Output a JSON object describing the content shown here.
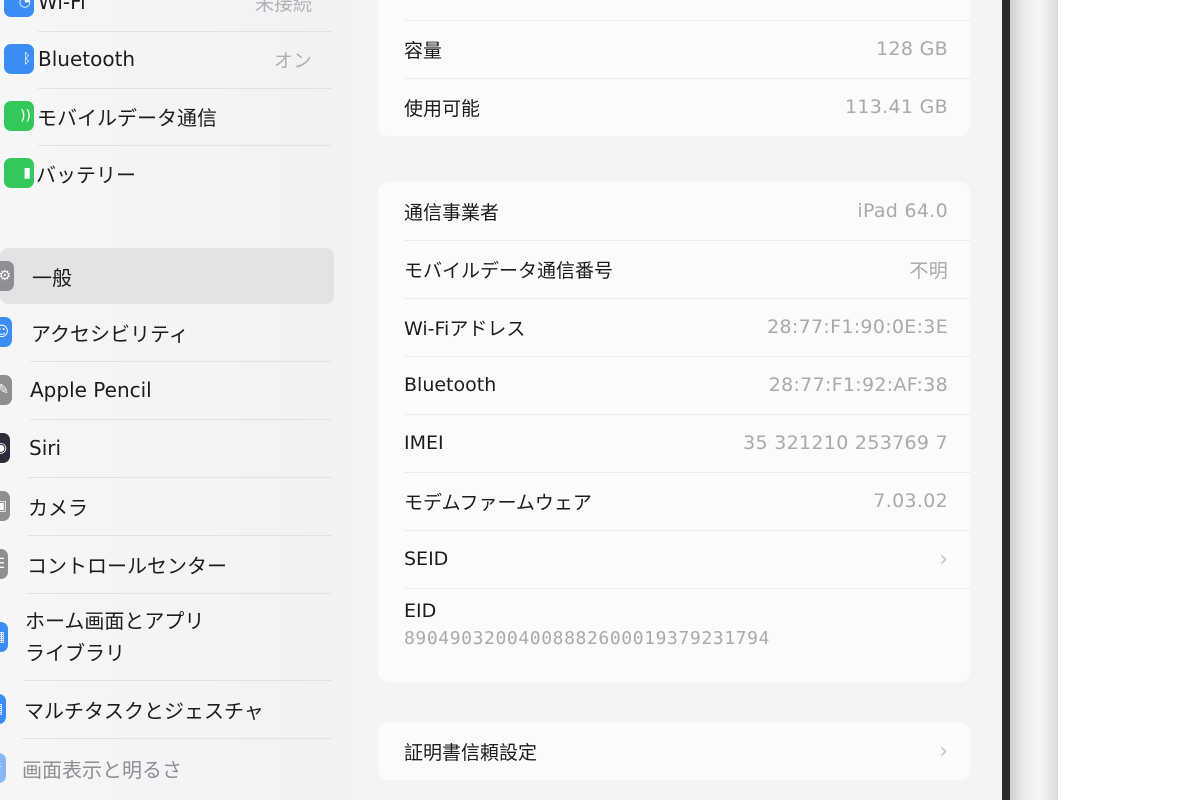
{
  "sidebar": {
    "items": [
      {
        "label": "Wi-Fi",
        "value": "未接続",
        "icon": "wifi-icon",
        "color": "#3b8cf5"
      },
      {
        "label": "Bluetooth",
        "value": "オン",
        "icon": "bluetooth-icon",
        "color": "#3b8cf5"
      },
      {
        "label": "モバイルデータ通信",
        "value": "",
        "icon": "antenna-icon",
        "color": "#34c759"
      },
      {
        "label": "バッテリー",
        "value": "",
        "icon": "battery-icon",
        "color": "#34c759"
      },
      {
        "label": "一般",
        "value": "",
        "icon": "gear-icon",
        "color": "#8e8e93"
      },
      {
        "label": "アクセシビリティ",
        "value": "",
        "icon": "accessibility-icon",
        "color": "#3b8cf5"
      },
      {
        "label": "Apple Pencil",
        "value": "",
        "icon": "pencil-icon",
        "color": "#8e8e93"
      },
      {
        "label": "Siri",
        "value": "",
        "icon": "siri-icon",
        "color": "#2d2d3a"
      },
      {
        "label": "カメラ",
        "value": "",
        "icon": "camera-icon",
        "color": "#8e8e93"
      },
      {
        "label": "コントロールセンター",
        "value": "",
        "icon": "control-center-icon",
        "color": "#8e8e93"
      },
      {
        "label": "ホーム画面とアプリライブラリ",
        "label_line1": "ホーム画面とアプリ",
        "label_line2": "ライブラリ",
        "value": "",
        "icon": "home-screen-icon",
        "color": "#3b8cf5"
      },
      {
        "label": "マルチタスクとジェスチャ",
        "value": "",
        "icon": "multitask-icon",
        "color": "#3b8cf5"
      },
      {
        "label": "画面表示と明るさ",
        "value": "",
        "icon": "display-icon",
        "color": "#3b8cf5"
      }
    ],
    "selected": "一般"
  },
  "main": {
    "storage_group": [
      {
        "label": "容量",
        "value": "128 GB"
      },
      {
        "label": "使用可能",
        "value": "113.41 GB"
      }
    ],
    "network_group": [
      {
        "label": "通信事業者",
        "value": "iPad 64.0"
      },
      {
        "label": "モバイルデータ通信番号",
        "value": "不明"
      },
      {
        "label": "Wi-Fiアドレス",
        "value": "28:77:F1:90:0E:3E"
      },
      {
        "label": "Bluetooth",
        "value": "28:77:F1:92:AF:38"
      },
      {
        "label": "IMEI",
        "value": "35 321210 253769 7"
      },
      {
        "label": "モデムファームウェア",
        "value": "7.03.02"
      },
      {
        "label": "SEID",
        "value": ""
      }
    ],
    "eid": {
      "label": "EID",
      "value": "89049032004008882600019379231794"
    },
    "cert_row": {
      "label": "証明書信頼設定"
    }
  }
}
